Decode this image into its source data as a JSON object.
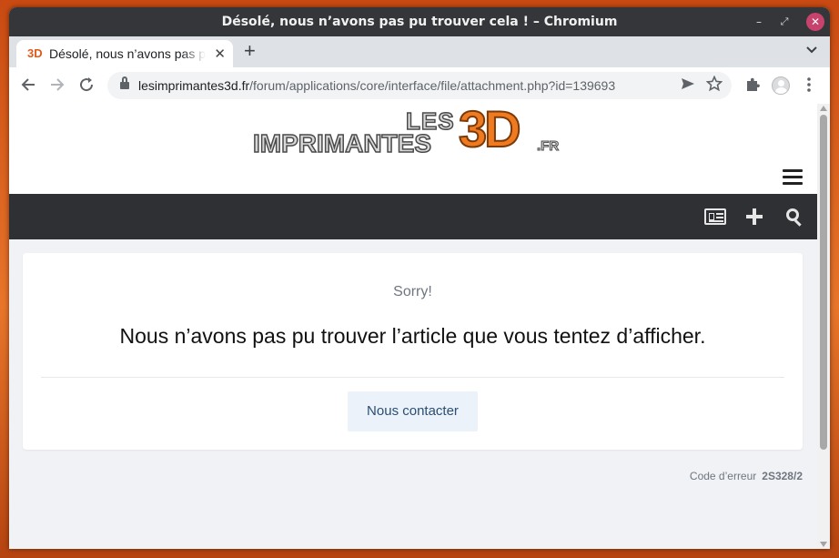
{
  "window": {
    "title": "Désolé, nous n’avons pas pu trouver cela ! – Chromium",
    "controls": {
      "minimize": "–",
      "maximize": "⤢",
      "close": "✕"
    }
  },
  "tab": {
    "favicon": "3D",
    "title": "Désolé, nous n’avons pas pu trouver cela !",
    "close": "✕",
    "new_tab": "+",
    "menu": "⌄"
  },
  "toolbar": {
    "url_host": "lesimprimantes3d.fr",
    "url_path": "/forum/applications/core/interface/file/attachment.php?id=139693",
    "icons": [
      "back-arrow-icon",
      "forward-arrow-icon",
      "reload-icon",
      "lock-icon",
      "send-icon",
      "star-icon",
      "extensions-icon",
      "profile-icon",
      "kebab-menu-icon"
    ]
  },
  "site": {
    "logo": {
      "les": "LES",
      "imprimantes": "IMPRIMANTES",
      "threed": "3D",
      "fr": ".FR"
    },
    "nav_icons": [
      "newspaper-icon",
      "plus-icon",
      "search-icon"
    ]
  },
  "error": {
    "sorry": "Sorry!",
    "message": "Nous n’avons pas pu trouver l’article que vous tentez d’afficher.",
    "contact_label": "Nous contacter",
    "code_label": "Code d’erreur",
    "code_value": "2S328/2"
  },
  "colors": {
    "accent": "#f07a1f",
    "navbar": "#2f3033",
    "button_bg": "#ebf2fa",
    "button_text": "#2b4e72",
    "close_button": "#c7436b"
  }
}
